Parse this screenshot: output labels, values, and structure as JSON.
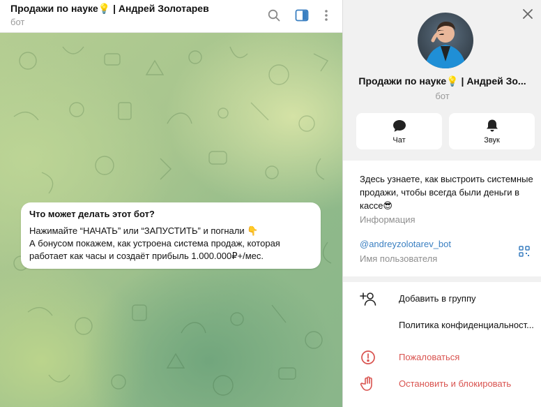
{
  "chat": {
    "title": "Продажи по науке💡 | Андрей Золотарев",
    "subtitle": "бот",
    "bot_card": {
      "title": "Что может делать этот бот?",
      "line1": "Нажимайте “НАЧАТЬ” или “ЗАПУСТИТЬ” и погнали 👇",
      "line2": "А бонусом покажем, как устроена система продаж, которая работает как часы и создаёт прибыль 1.000.000₽+/мес."
    }
  },
  "header_icons": [
    "search-icon",
    "sidebar-toggle-icon",
    "more-vertical-icon"
  ],
  "profile": {
    "name": "Продажи по науке💡 | Андрей Зо...",
    "subtitle": "бот",
    "actions": [
      {
        "label": "Чат",
        "icon": "chat-icon"
      },
      {
        "label": "Звук",
        "icon": "bell-icon"
      }
    ],
    "description": "Здесь узнаете, как выстроить системные продажи, чтобы всегда были деньги в кассе😎",
    "description_label": "Информация",
    "username": "@andreyzolotarev_bot",
    "username_label": "Имя пользователя"
  },
  "menu": [
    {
      "label": "Добавить в группу",
      "icon": "add-user-icon",
      "danger": false
    },
    {
      "label": "Политика конфиденциальност...",
      "icon": "",
      "danger": false
    },
    {
      "label": "Пожаловаться",
      "icon": "warning-icon",
      "danger": true
    },
    {
      "label": "Остановить и блокировать",
      "icon": "hand-stop-icon",
      "danger": true
    }
  ],
  "colors": {
    "accent": "#3a7fc1",
    "danger": "#d9534f",
    "muted": "#9a9a9a"
  }
}
